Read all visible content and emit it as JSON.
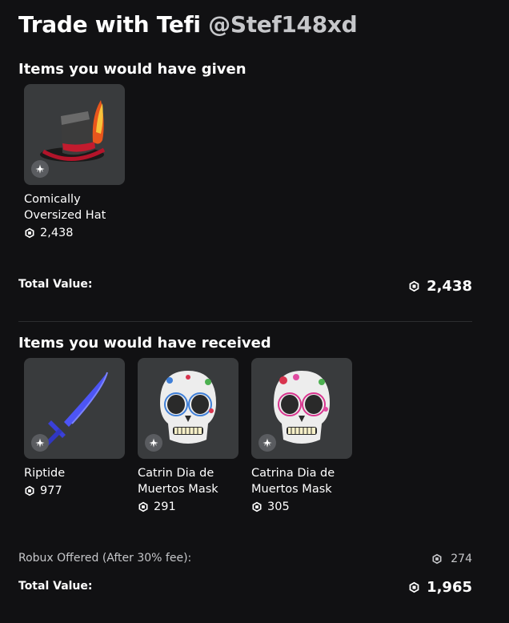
{
  "header": {
    "title": "Trade with Tefi",
    "username": "@Stef148xd"
  },
  "given": {
    "heading": "Items you would have given",
    "items": [
      {
        "name": "Comically Oversized Hat",
        "price": "2,438",
        "icon": "oversized-hat"
      }
    ],
    "total_label": "Total Value:",
    "total_value": "2,438"
  },
  "received": {
    "heading": "Items you would have received",
    "items": [
      {
        "name": "Riptide",
        "price": "977",
        "icon": "blue-sword"
      },
      {
        "name": "Catrin Dia de Muertos Mask",
        "price": "291",
        "icon": "sugar-skull-mask-blue"
      },
      {
        "name": "Catrina Dia de Muertos Mask",
        "price": "305",
        "icon": "sugar-skull-mask-pink"
      }
    ],
    "robux_offered_label": "Robux Offered (After 30% fee):",
    "robux_offered_value": "274",
    "total_label": "Total Value:",
    "total_value": "1,965"
  },
  "colors": {
    "background": "#111113",
    "card": "#393b3d",
    "text": "#ffffff",
    "muted_text": "#c6c7ca"
  }
}
